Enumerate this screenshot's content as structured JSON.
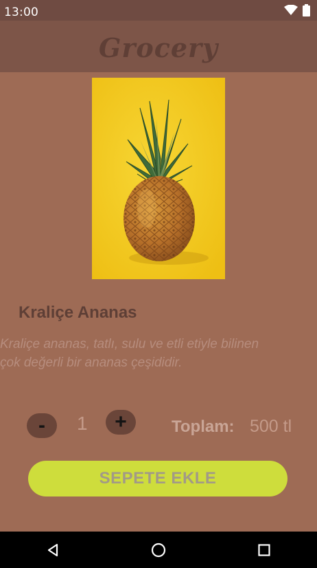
{
  "status_bar": {
    "time": "13:00",
    "icons": [
      "wifi-icon",
      "battery-icon"
    ]
  },
  "app_bar": {
    "title": "Grocery"
  },
  "product": {
    "image_icon": "pineapple-image",
    "name": "Kraliçe Ananas",
    "description_line1": "Kraliçe ananas, tatlı, sulu ve etli etiyle bilinen",
    "description_line2": "çok değerli bir ananas çeşididir."
  },
  "quantity": {
    "minus_label": "-",
    "value": "1",
    "plus_label": "+"
  },
  "total": {
    "label": "Toplam:",
    "value": "500 tl"
  },
  "add_to_cart": {
    "label": "SEPETE EKLE"
  },
  "navigation": {
    "icons": [
      "back-icon",
      "home-icon",
      "recents-icon"
    ]
  },
  "colors": {
    "background": "#9e6b55",
    "app_bar": "#7d5548",
    "status_bar": "#6f4b42",
    "button": "#cedd3c",
    "image_background": "#f2c81c"
  }
}
